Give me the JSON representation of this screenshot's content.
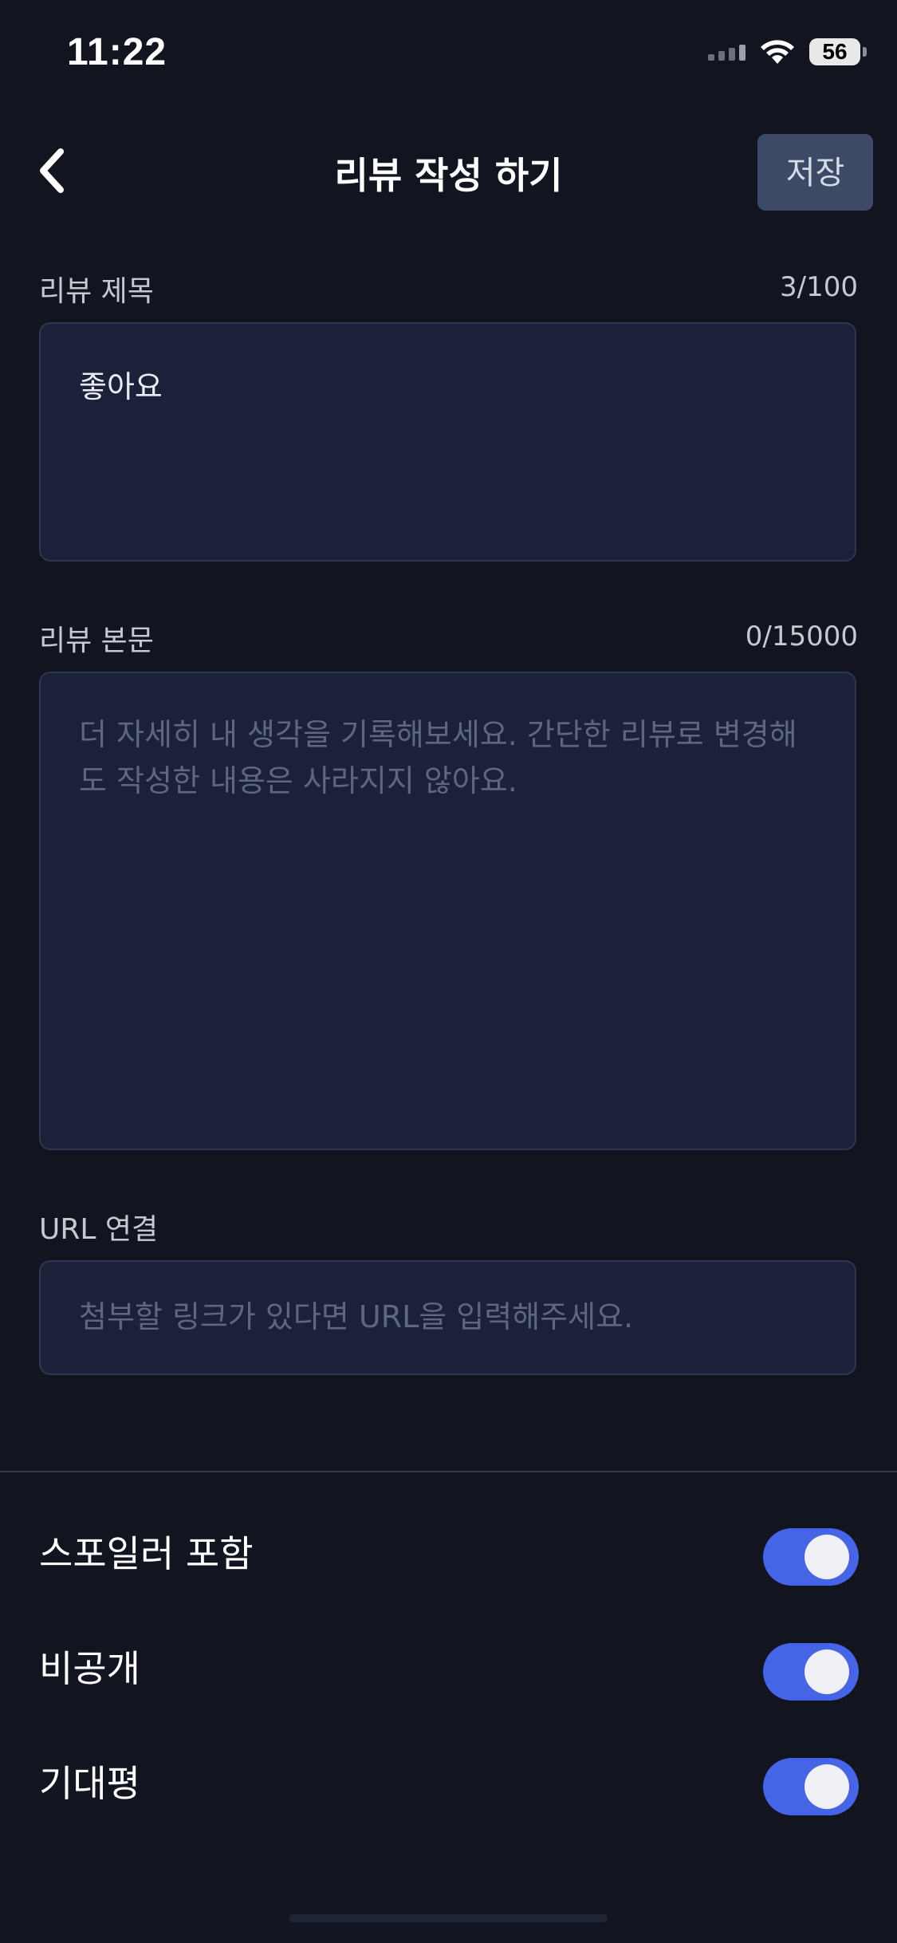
{
  "status_bar": {
    "time": "11:22",
    "battery": "56",
    "wifi_icon": "wifi-icon",
    "signal_icon": "cellular-signal-icon"
  },
  "header": {
    "back_icon": "chevron-left-icon",
    "title": "리뷰 작성 하기",
    "save_label": "저장"
  },
  "review_title": {
    "label": "리뷰 제목",
    "counter": "3/100",
    "value": "좋아요"
  },
  "review_body": {
    "label": "리뷰 본문",
    "counter": "0/15000",
    "placeholder": "더 자세히 내 생각을 기록해보세요. 간단한 리뷰로 변경해도 작성한 내용은 사라지지 않아요."
  },
  "url": {
    "label": "URL 연결",
    "placeholder": "첨부할 링크가 있다면 URL을 입력해주세요."
  },
  "toggles": [
    {
      "label": "스포일러 포함",
      "on": true
    },
    {
      "label": "비공개",
      "on": true
    },
    {
      "label": "기대평",
      "on": true
    }
  ],
  "colors": {
    "background": "#12141f",
    "field_bg": "#1a2138",
    "toggle_on": "#4664e6",
    "save_button": "#3d4a66"
  }
}
